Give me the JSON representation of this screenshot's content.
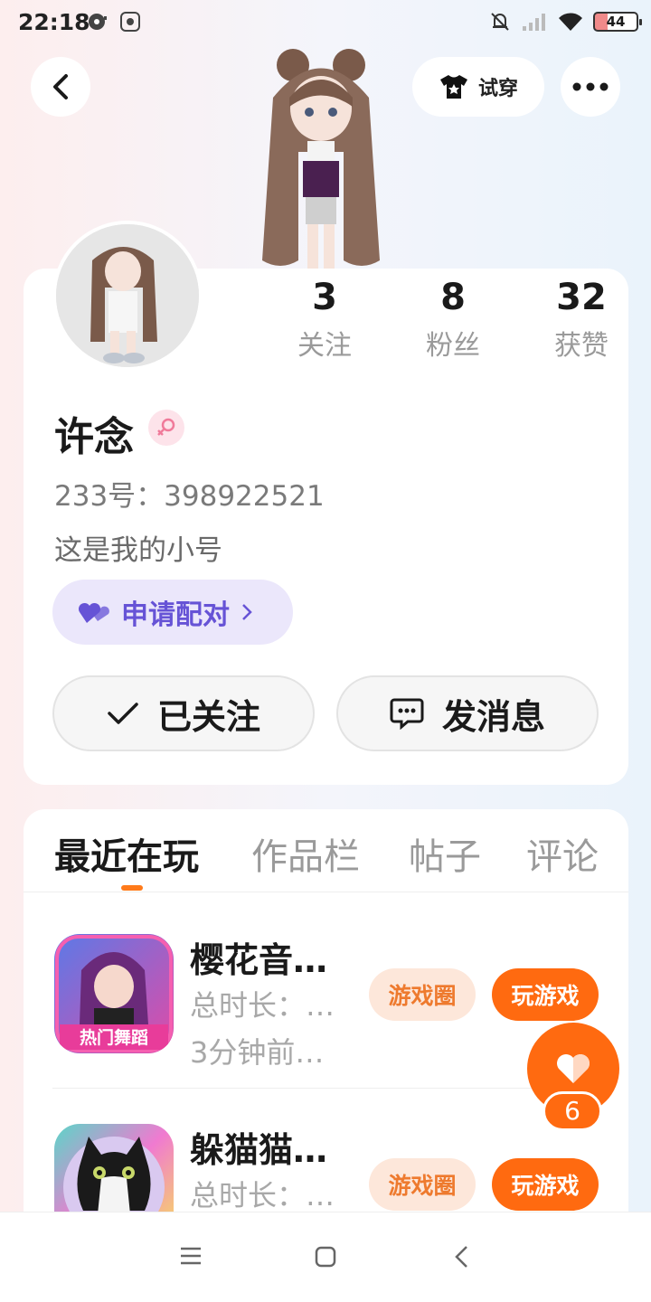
{
  "status_bar": {
    "time": "22:18",
    "battery": "44",
    "icons": [
      "disc-icon",
      "app-notification-icon",
      "mute-icon",
      "signal-icon",
      "wifi-icon",
      "battery-icon"
    ]
  },
  "header": {
    "back_icon": "chevron-left-icon",
    "try_on_label": "试穿",
    "try_on_icon": "tshirt-icon",
    "more_icon": "more-dots-icon"
  },
  "profile": {
    "stats": [
      {
        "value": "3",
        "label": "关注"
      },
      {
        "value": "8",
        "label": "粉丝"
      },
      {
        "value": "32",
        "label": "获赞"
      }
    ],
    "name": "许念",
    "gender_icon": "female-icon",
    "uid": "233号：398922521",
    "bio": "这是我的小号",
    "pair_label": "申请配对",
    "follow_label": "已关注",
    "message_label": "发消息"
  },
  "tabs": [
    {
      "label": "最近在玩",
      "active": true
    },
    {
      "label": "作品栏",
      "active": false
    },
    {
      "label": "帖子",
      "active": false
    },
    {
      "label": "评论",
      "active": false
    }
  ],
  "games": [
    {
      "title": "樱花音…",
      "duration": "总时长：…",
      "last_played": "3分钟前…",
      "icon_text": "热门舞蹈",
      "circle_label": "游戏圈",
      "play_label": "玩游戏"
    },
    {
      "title": "躲猫猫…",
      "duration": "总时长：…",
      "circle_label": "游戏圈",
      "play_label": "玩游戏"
    }
  ],
  "like": {
    "count": "6"
  },
  "colors": {
    "accent": "#ff6a10",
    "pair": "#6653d6"
  }
}
